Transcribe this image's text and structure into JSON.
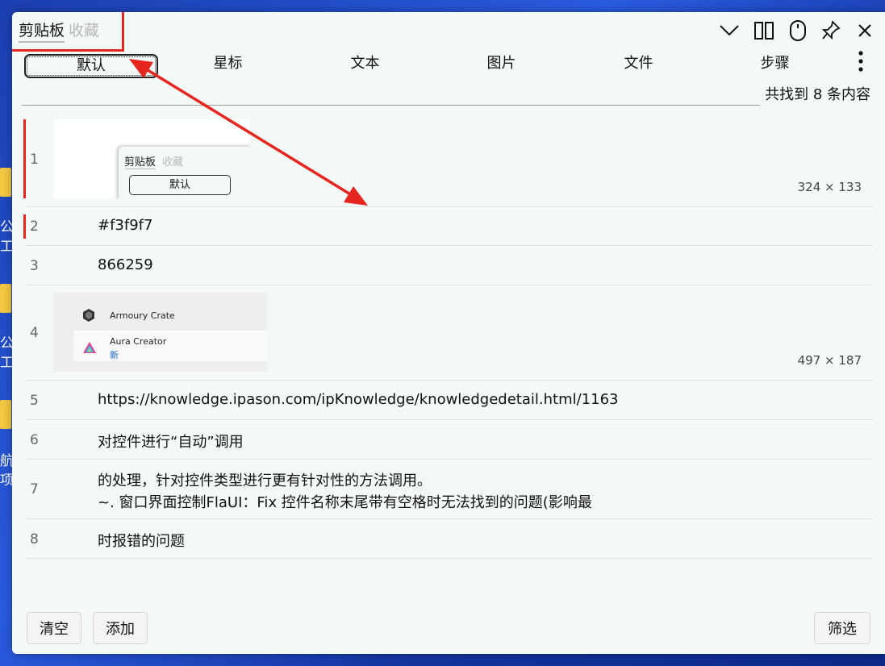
{
  "desktop": {
    "labels": [
      "公",
      "工",
      "公",
      "工",
      "航",
      "项"
    ]
  },
  "window": {
    "tabs": [
      {
        "label": "剪贴板",
        "active": true
      },
      {
        "label": "收藏",
        "active": false
      }
    ],
    "controls": [
      "chevron-down-icon",
      "split-columns-icon",
      "mouse-icon",
      "pin-icon",
      "close-icon"
    ]
  },
  "categories": [
    {
      "label": "默认",
      "active": true
    },
    {
      "label": "星标"
    },
    {
      "label": "文本"
    },
    {
      "label": "图片"
    },
    {
      "label": "文件"
    },
    {
      "label": "步骤"
    }
  ],
  "result_count": "共找到 8 条内容",
  "items": [
    {
      "num": "1",
      "type": "image",
      "dims": "324 × 133",
      "marked": true,
      "thumb": {
        "tab1": "剪贴板",
        "tab2": "收藏",
        "button": "默认"
      }
    },
    {
      "num": "2",
      "type": "text",
      "text": "#f3f9f7",
      "marked": true
    },
    {
      "num": "3",
      "type": "text",
      "text": "866259"
    },
    {
      "num": "4",
      "type": "image",
      "dims": "497 × 187",
      "thumb": {
        "app1": "Armoury Crate",
        "app2": "Aura Creator",
        "badge": "新"
      }
    },
    {
      "num": "5",
      "type": "text",
      "text": "https://knowledge.ipason.com/ipKnowledge/knowledgedetail.html/1163"
    },
    {
      "num": "6",
      "type": "text",
      "text": "对控件进行“自动”调用"
    },
    {
      "num": "7",
      "type": "text",
      "line1": "的处理，针对控件类型进行更有针对性的方法调用。",
      "line2": "~. 窗口界面控制FlaUI：Fix 控件名称末尾带有空格时无法找到的问题(影响最"
    },
    {
      "num": "8",
      "type": "text",
      "text": "时报错的问题"
    }
  ],
  "footer": {
    "clear": "清空",
    "add": "添加",
    "filter": "筛选"
  },
  "colors": {
    "background": "#f3f9f7",
    "annotation": "#e5261f"
  }
}
